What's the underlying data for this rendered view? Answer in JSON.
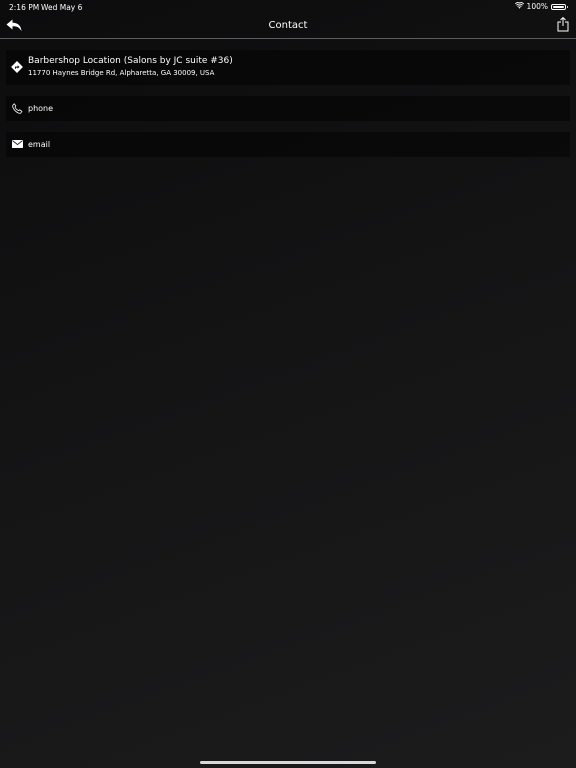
{
  "status_bar": {
    "time": "2:16 PM",
    "date": "Wed May 6",
    "battery_percent": "100%",
    "battery_level": 1.0,
    "wifi_icon": "wifi-icon"
  },
  "nav": {
    "title": "Contact",
    "back_icon": "back-arrow-icon",
    "share_icon": "share-icon"
  },
  "contact": {
    "location": {
      "icon": "directions-icon",
      "title": "Barbershop Location (Salons by JC suite #36)",
      "address": "11770 Haynes Bridge Rd, Alpharetta, GA 30009, USA"
    },
    "phone": {
      "icon": "phone-icon",
      "label": "phone"
    },
    "email": {
      "icon": "mail-icon",
      "label": "email"
    }
  },
  "colors": {
    "background": "#121213",
    "text": "#ffffff",
    "divider": "#5c5c5e"
  }
}
